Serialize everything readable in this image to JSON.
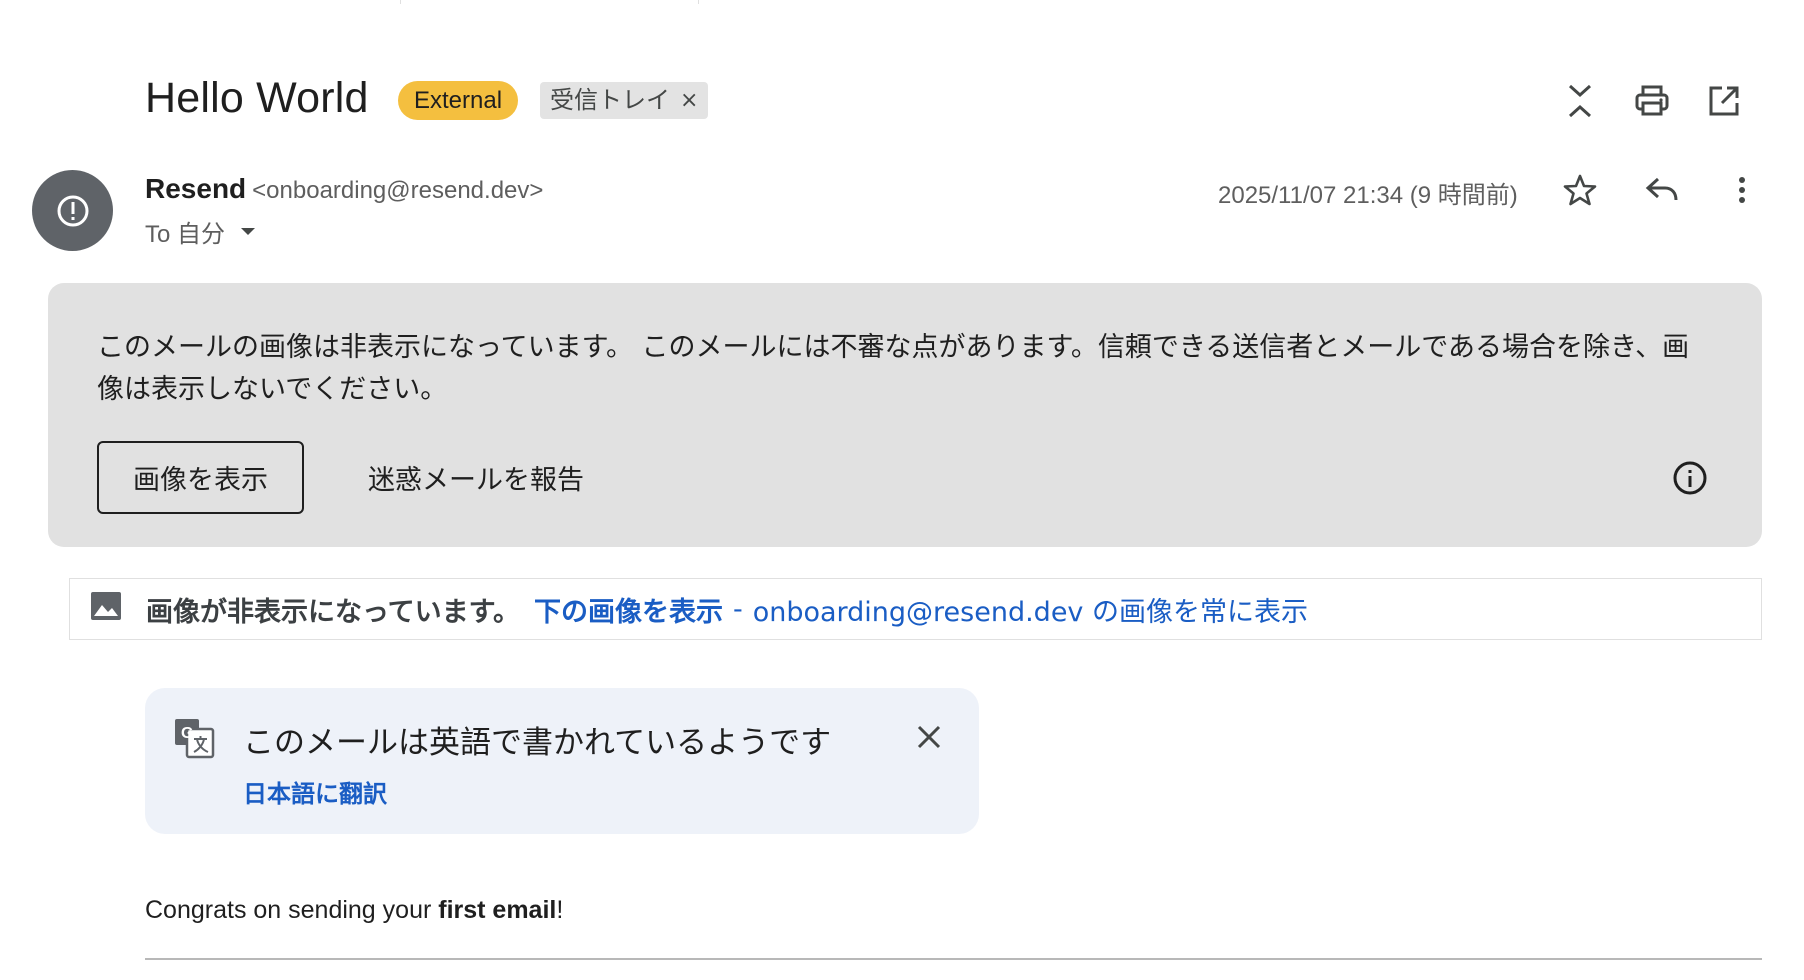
{
  "subject": "Hello World",
  "badges": {
    "external": "External",
    "label": "受信トレイ",
    "label_remove": "×"
  },
  "header_icons": [
    "collapse-all-icon",
    "print-icon",
    "open-in-new-window-icon"
  ],
  "sender": {
    "name": "Resend",
    "address": "<onboarding@resend.dev>",
    "to_label": "To 自分",
    "date": "2025/11/07 21:34 (9 時間前)"
  },
  "message_icons": [
    "star-icon",
    "reply-icon",
    "more-options-icon"
  ],
  "warning": {
    "text": "このメールの画像は非表示になっています。 このメールには不審な点があります。信頼できる送信者とメールである場合を除き、画像は表示しないでください。",
    "show_images_button": "画像を表示",
    "report_spam_button": "迷惑メールを報告"
  },
  "images_bar": {
    "status": "画像が非表示になっています。",
    "show_below": "下の画像を表示",
    "separator": "-",
    "always_show": "onboarding@resend.dev の画像を常に表示"
  },
  "translate": {
    "message": "このメールは英語で書かれているようです",
    "action": "日本語に翻訳"
  },
  "body": {
    "prefix": "Congrats on sending your ",
    "bold": "first email",
    "suffix": "!"
  },
  "colors": {
    "external_badge": "#f4bf3f",
    "label_badge": "#e3e3e3",
    "warning_bg": "#e1e1e1",
    "link": "#1a5dc4",
    "translate_bg": "#eef2f9",
    "avatar_bg": "#5f6368"
  }
}
